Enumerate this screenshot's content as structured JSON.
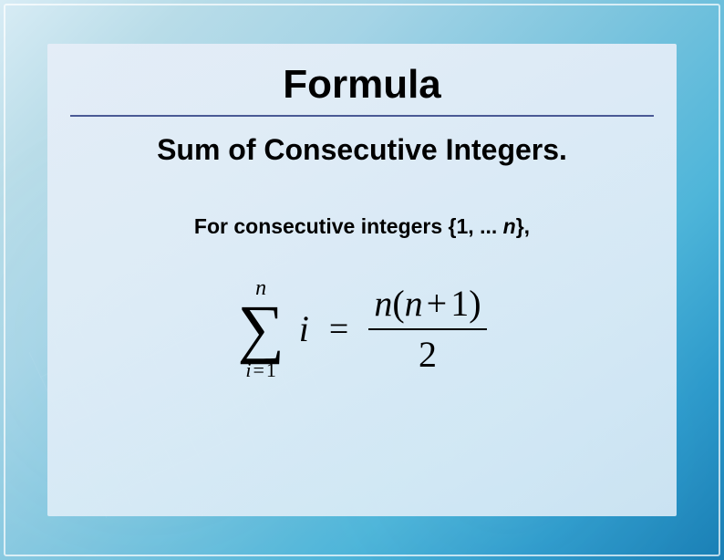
{
  "card": {
    "title": "Formula",
    "subtitle": "Sum of Consecutive Integers.",
    "description_prefix": "For consecutive integers {1, ... ",
    "description_var": "n",
    "description_suffix": "},"
  },
  "formula": {
    "sigma_upper": "n",
    "sigma_lower_var": "i",
    "sigma_lower_eq": "=",
    "sigma_lower_val": "1",
    "summand": "i",
    "equals": "=",
    "numerator_n1": "n",
    "numerator_lparen": "(",
    "numerator_n2": "n",
    "numerator_plus": "+",
    "numerator_one": "1",
    "numerator_rparen": ")",
    "denominator": "2"
  }
}
